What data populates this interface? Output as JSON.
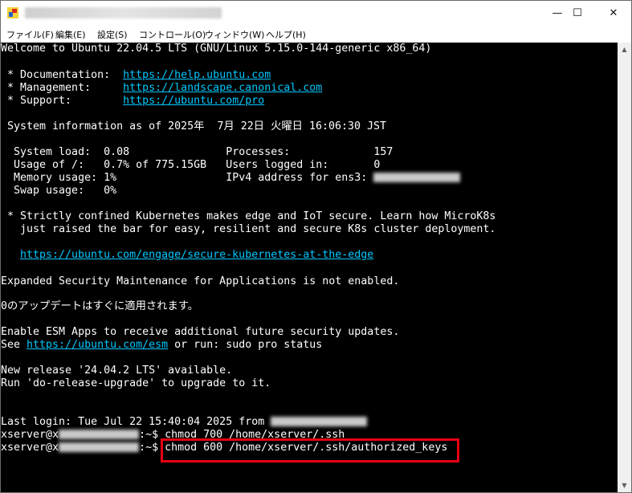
{
  "window": {
    "controls": {
      "minimize": "—",
      "maximize": "☐",
      "close": "✕"
    }
  },
  "menu": [
    "ファイル(F)",
    "編集(E)",
    "設定(S)",
    "コントロール(O)",
    "ウィンドウ(W)",
    "ヘルプ(H)"
  ],
  "terminal": {
    "welcome": "Welcome to Ubuntu 22.04.5 LTS (GNU/Linux 5.15.0-144-generic x86_64)",
    "doc_label": " * Documentation:  ",
    "doc_url": "https://help.ubuntu.com",
    "mgmt_label": " * Management:     ",
    "mgmt_url": "https://landscape.canonical.com",
    "support_label": " * Support:        ",
    "support_url": "https://ubuntu.com/pro",
    "sysinfo": " System information as of 2025年  7月 22日 火曜日 16:06:30 JST",
    "sys1": "  System load:  0.08               Processes:             157",
    "sys2": "  Usage of /:   0.7% of 775.15GB   Users logged in:       0",
    "sys3": "  Memory usage: 1%                 IPv4 address for ens3: ",
    "sys4": "  Swap usage:   0%",
    "k8s1": " * Strictly confined Kubernetes makes edge and IoT secure. Learn how MicroK8s",
    "k8s2": "   just raised the bar for easy, resilient and secure K8s cluster deployment.",
    "k8s_url": "https://ubuntu.com/engage/secure-kubernetes-at-the-edge",
    "esm1": "Expanded Security Maintenance for Applications is not enabled.",
    "updates": "0のアップデートはすぐに適用されます。",
    "esm2": "Enable ESM Apps to receive additional future security updates.",
    "see_prefix": "See ",
    "esm_url": "https://ubuntu.com/esm",
    "see_suffix": " or run: sudo pro status",
    "release1": "New release '24.04.2 LTS' available.",
    "release2": "Run 'do-release-upgrade' to upgrade to it.",
    "last_login": "Last login: Tue Jul 22 15:40:04 2025 from ",
    "prompt_user": "xserver@x",
    "prompt_tail": ":~$ ",
    "cmd1": "chmod 700 /home/xserver/.ssh",
    "cmd2": "chmod 600 /home/xserver/.ssh/authorized_keys"
  },
  "colors": {
    "background": "#000000",
    "text": "#ffffff",
    "link": "#00c8ff",
    "highlight": "#e60012"
  }
}
